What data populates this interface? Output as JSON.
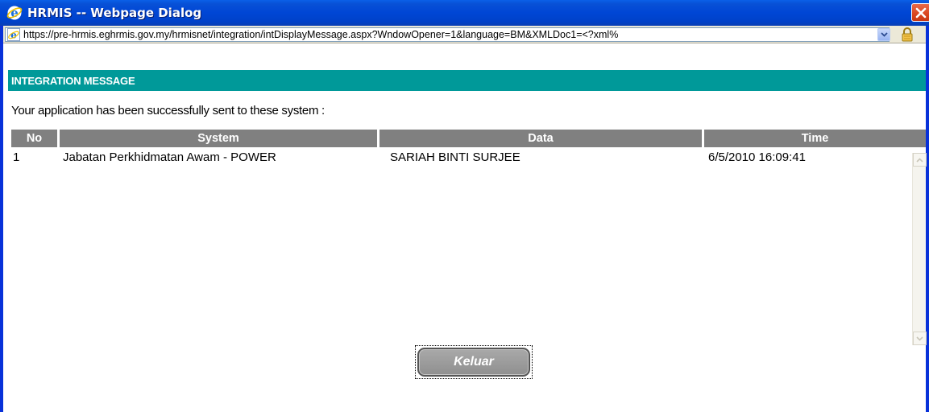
{
  "window": {
    "title": "HRMIS -- Webpage Dialog",
    "close_icon": "close-icon"
  },
  "address": {
    "url": "https://pre-hrmis.eghrmis.gov.my/hrmisnet/integration/intDisplayMessage.aspx?WndowOpener=1&language=BM&XMLDoc1=<?xml%",
    "page_icon": "ie-page-icon",
    "lock_icon": "lock-icon"
  },
  "header": {
    "title": "INTEGRATION MESSAGE",
    "band_color": "#009999"
  },
  "message": {
    "intro": "Your application has been successfully sent to these system :"
  },
  "table": {
    "columns": [
      "No",
      "System",
      "Data",
      "Time"
    ],
    "header_color": "#808080",
    "rows": [
      {
        "no": "1",
        "system": "Jabatan Perkhidmatan Awam - POWER",
        "data": "SARIAH BINTI SURJEE",
        "time": "6/5/2010 16:09:41"
      }
    ]
  },
  "actions": {
    "keluar_label": "Keluar"
  }
}
